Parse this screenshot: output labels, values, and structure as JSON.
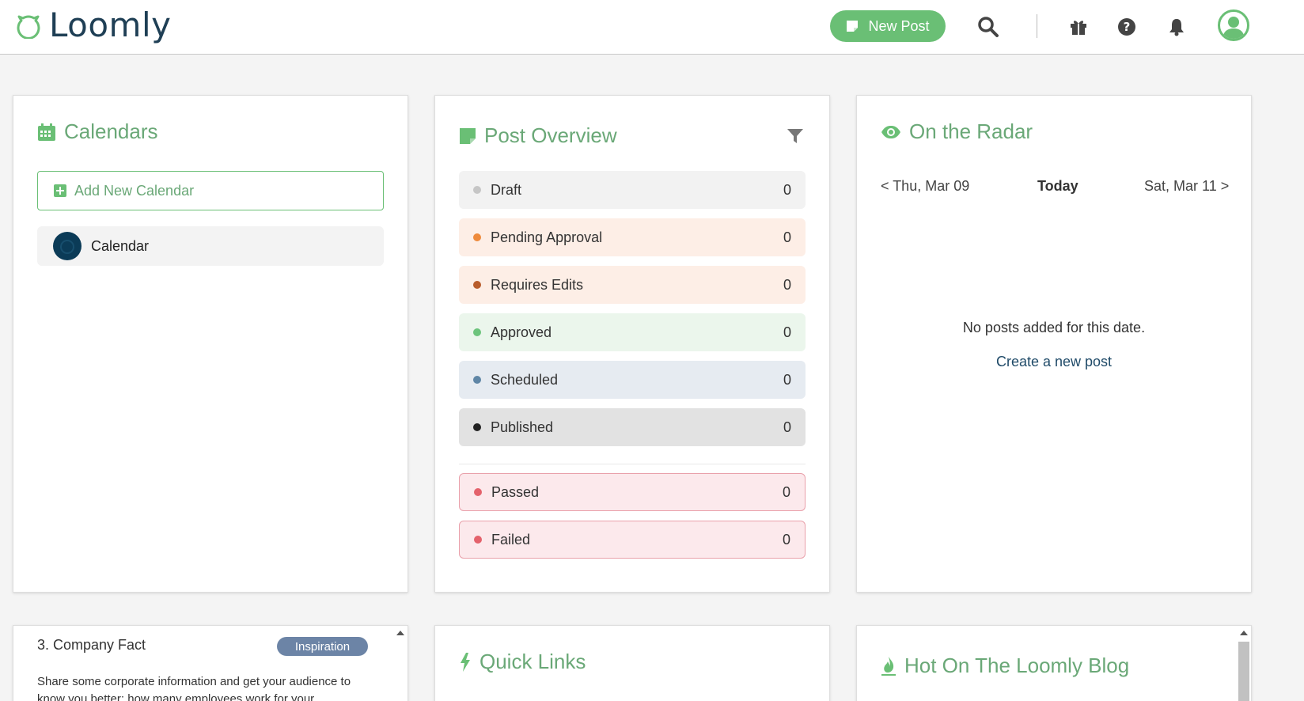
{
  "header": {
    "logo_text": "Loomly",
    "new_post_label": "New Post",
    "icons": [
      "search-icon",
      "gift-icon",
      "help-icon",
      "bell-icon",
      "user-avatar-icon"
    ]
  },
  "colors": {
    "brand_green": "#6abf75",
    "title_green": "#6aa877",
    "navy": "#1f3f55"
  },
  "calendars": {
    "title": "Calendars",
    "add_label": "Add New Calendar",
    "items": [
      {
        "label": "Calendar"
      }
    ]
  },
  "post_overview": {
    "title": "Post Overview",
    "statuses": [
      {
        "label": "Draft",
        "count": "0",
        "dot": "#c6c6c6",
        "bg": "#f2f2f2"
      },
      {
        "label": "Pending Approval",
        "count": "0",
        "dot": "#ee8a3c",
        "bg": "#fdeee6"
      },
      {
        "label": "Requires Edits",
        "count": "0",
        "dot": "#b85c2b",
        "bg": "#fdeee6"
      },
      {
        "label": "Approved",
        "count": "0",
        "dot": "#6cc47c",
        "bg": "#ebf6ec"
      },
      {
        "label": "Scheduled",
        "count": "0",
        "dot": "#5f86a6",
        "bg": "#e6ebf1"
      },
      {
        "label": "Published",
        "count": "0",
        "dot": "#222222",
        "bg": "#e2e2e2"
      }
    ],
    "alerts": [
      {
        "label": "Passed",
        "count": "0",
        "dot": "#e4626c",
        "bg": "#fce9ec"
      },
      {
        "label": "Failed",
        "count": "0",
        "dot": "#e4626c",
        "bg": "#fce9ec"
      }
    ]
  },
  "radar": {
    "title": "On the Radar",
    "prev_label": "< Thu, Mar 09",
    "today_label": "Today",
    "next_label": "Sat, Mar 11 >",
    "empty_text": "No posts added for this date.",
    "create_link": "Create a new post"
  },
  "company_fact": {
    "title": "3. Company Fact",
    "badge": "Inspiration",
    "body": "Share some corporate information and get your audience to know you better: how many employees work for your"
  },
  "quick_links": {
    "title": "Quick Links"
  },
  "blog": {
    "title": "Hot On The Loomly Blog"
  }
}
